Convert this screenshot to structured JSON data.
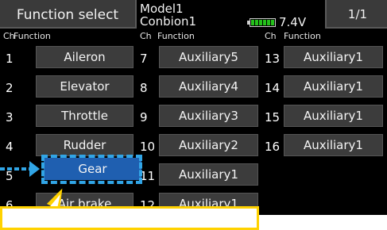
{
  "header": {
    "title": "Function select",
    "model_name": "Model1",
    "model_type": "Conbion1",
    "battery_voltage": "7.4V",
    "battery_level": 1.0,
    "page_indicator": "1/1"
  },
  "columns": [
    {
      "ch_label": "Ch",
      "function_label": "Function"
    },
    {
      "ch_label": "Ch",
      "function_label": "Function"
    },
    {
      "ch_label": "Ch",
      "function_label": "Function"
    }
  ],
  "channels": [
    {
      "ch": "1",
      "function": "Aileron"
    },
    {
      "ch": "2",
      "function": "Elevator"
    },
    {
      "ch": "3",
      "function": "Throttle"
    },
    {
      "ch": "4",
      "function": "Rudder"
    },
    {
      "ch": "5",
      "function": "Gear"
    },
    {
      "ch": "6",
      "function": "Air brake"
    },
    {
      "ch": "7",
      "function": "Auxiliary5"
    },
    {
      "ch": "8",
      "function": "Auxiliary4"
    },
    {
      "ch": "9",
      "function": "Auxiliary3"
    },
    {
      "ch": "10",
      "function": "Auxiliary2"
    },
    {
      "ch": "11",
      "function": "Auxiliary1"
    },
    {
      "ch": "12",
      "function": "Auxiliary1"
    },
    {
      "ch": "13",
      "function": "Auxiliary1"
    },
    {
      "ch": "14",
      "function": "Auxiliary1"
    },
    {
      "ch": "15",
      "function": "Auxiliary1"
    },
    {
      "ch": "16",
      "function": "Auxiliary1"
    }
  ],
  "selected_channel": "5",
  "colors": {
    "screen_bg": "#000000",
    "button_bg": "#3c3c3c",
    "selected_bg": "#1f5fb0",
    "highlight_frame": "#31a5e6",
    "callout_border": "#ffd200",
    "battery_fill": "#25c21b"
  },
  "icons": {
    "battery": "battery-icon",
    "pointer": "arrow-right-icon"
  }
}
